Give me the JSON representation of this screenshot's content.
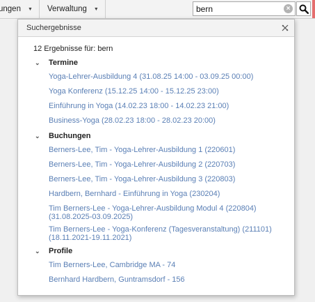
{
  "toolbar": {
    "menu1_label": "ungen",
    "menu2_label": "Verwaltung",
    "search_value": "bern",
    "clear_glyph": "×",
    "accent_color": "#e46e6e"
  },
  "popup": {
    "title": "Suchergebnisse",
    "count_text": "12 Ergebnisse für: bern",
    "sections": {
      "termine": {
        "label": "Termine",
        "items": [
          "Yoga-Lehrer-Ausbildung 4 (31.08.25 14:00 - 03.09.25 00:00)",
          "Yoga Konferenz (15.12.25 14:00 - 15.12.25 23:00)",
          "Einführung in Yoga (14.02.23 18:00 - 14.02.23 21:00)",
          "Business-Yoga (28.02.23 18:00 - 28.02.23 20:00)"
        ]
      },
      "buchungen": {
        "label": "Buchungen",
        "items": [
          "Berners-Lee, Tim - Yoga-Lehrer-Ausbildung 1 (220601)",
          "Berners-Lee, Tim - Yoga-Lehrer-Ausbildung 2 (220703)",
          "Berners-Lee, Tim - Yoga-Lehrer-Ausbildung 3 (220803)",
          "Hardbern, Bernhard - Einführung in Yoga (230204)",
          {
            "line1": "Tim Berners-Lee - Yoga-Lehrer-Ausbildung Modul 4 (220804)",
            "line2": "(31.08.2025-03.09.2025)"
          },
          {
            "line1": "Tim Berners-Lee - Yoga-Konferenz (Tagesveranstaltung) (211101)",
            "line2": "(18.11.2021-19.11.2021)"
          }
        ]
      },
      "profile": {
        "label": "Profile",
        "items": [
          "Tim Berners-Lee, Cambridge MA - 74",
          "Bernhard Hardbern, Guntramsdorf - 156"
        ]
      }
    },
    "link_color": "#5a7fb5"
  }
}
